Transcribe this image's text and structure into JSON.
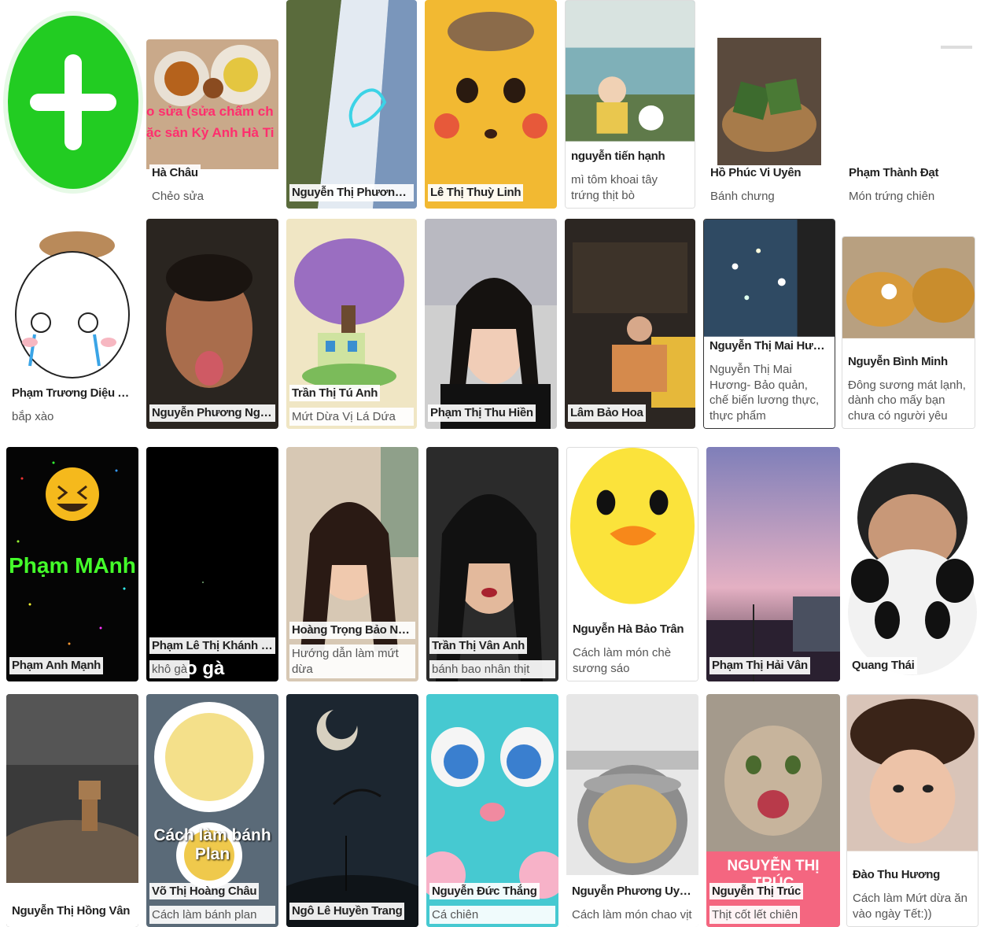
{
  "add_button": {
    "icon": "plus-circle-icon",
    "color": "#22cc22"
  },
  "cards": [
    {
      "id": "c1",
      "name": "Hà Châu",
      "desc": "Chẻo sửa",
      "overlay": "o sửa (sửa chấm ch\nặc sản Kỳ Anh Hà Ti"
    },
    {
      "id": "c2",
      "name": "Nguyễn Thị Phương Thảo",
      "desc": ""
    },
    {
      "id": "c3",
      "name": "Lê Thị Thuỳ Linh",
      "desc": ""
    },
    {
      "id": "c4",
      "name": "nguyễn tiến hạnh",
      "desc": "mì tôm khoai tây trứng thịt bò"
    },
    {
      "id": "c5",
      "name": "Hồ Phúc Vi Uyên",
      "desc": "Bánh chưng"
    },
    {
      "id": "c6",
      "name": "Phạm Thành Đạt",
      "desc": "Món trứng chiên"
    },
    {
      "id": "c7",
      "name": "Phạm Trương Diệu Anh",
      "desc": "bắp xào"
    },
    {
      "id": "c8",
      "name": "Nguyễn Phương Ngọc",
      "desc": ""
    },
    {
      "id": "c9",
      "name": "Trần Thị Tú Anh",
      "desc": "Mứt Dừa Vị Lá Dứa"
    },
    {
      "id": "c10",
      "name": "Phạm Thị Thu Hiền",
      "desc": ""
    },
    {
      "id": "c11",
      "name": "Lâm Bảo Hoa",
      "desc": ""
    },
    {
      "id": "c12",
      "name": "Nguyễn Thị Mai Hương",
      "desc": "Nguyễn Thị Mai Hương- Bảo quản, chế biến lương thực, thực phẩm"
    },
    {
      "id": "c13",
      "name": "Nguyễn Bình Minh",
      "desc": "Đông sương mát lạnh, dành cho mấy bạn chưa có người yêu"
    },
    {
      "id": "c14",
      "name": "Phạm Anh Mạnh",
      "desc": "",
      "overlay": "Phạm MAnh"
    },
    {
      "id": "c15",
      "name": "Phạm Lê Thị Khánh Huy...",
      "desc": "khô gà",
      "overlay": "o gà"
    },
    {
      "id": "c16",
      "name": "Hoàng Trọng Bảo Ngọc",
      "desc": "Hướng dẫn làm mứt dừa"
    },
    {
      "id": "c17",
      "name": "Trần Thị Vân Anh",
      "desc": "bánh bao nhân thịt"
    },
    {
      "id": "c18",
      "name": "Nguyễn Hà Bảo Trân",
      "desc": "Cách làm món chè sương sáo"
    },
    {
      "id": "c19",
      "name": "Phạm Thị Hải Vân",
      "desc": ""
    },
    {
      "id": "c20",
      "name": "Quang Thái",
      "desc": ""
    },
    {
      "id": "c21",
      "name": "Nguyễn Thị Hồng Vân",
      "desc": ""
    },
    {
      "id": "c22",
      "name": "Võ Thị Hoàng Châu",
      "desc": "Cách làm bánh plan",
      "overlay": "Cách làm bánh Plan"
    },
    {
      "id": "c23",
      "name": "Ngô Lê Huyền Trang",
      "desc": ""
    },
    {
      "id": "c24",
      "name": "Nguyễn Đức Thắng",
      "desc": "Cá chiên"
    },
    {
      "id": "c25",
      "name": "Nguyễn Phương Uyên A",
      "desc": "Cách làm món chao vịt"
    },
    {
      "id": "c26",
      "name": "Nguyễn Thị Trúc",
      "desc": "Thịt cốt lết chiên",
      "overlay": "NGUYỄN THỊ TRÚC"
    },
    {
      "id": "c27",
      "name": "Đào Thu Hương",
      "desc": "Cách làm Mứt dừa ăn vào ngày Tết:))"
    }
  ]
}
